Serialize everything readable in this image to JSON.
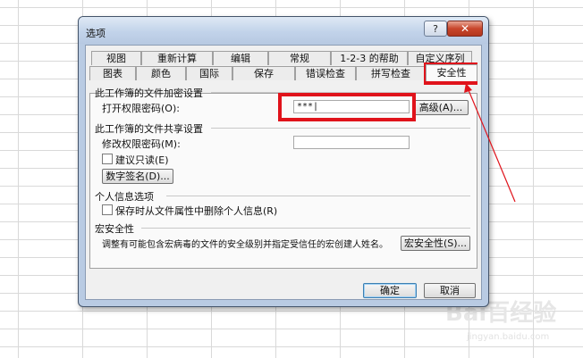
{
  "dialog": {
    "title": "选项",
    "help": "?",
    "close": "✕"
  },
  "tabs": {
    "row1": [
      "视图",
      "重新计算",
      "编辑",
      "常规",
      "1-2-3 的帮助",
      "自定义序列"
    ],
    "row2": [
      "图表",
      "颜色",
      "国际",
      "保存",
      "错误检查",
      "拼写检查",
      "安全性"
    ],
    "active": "安全性"
  },
  "encrypt": {
    "group": "此工作簿的文件加密设置",
    "open_label": "打开权限密码(O):",
    "open_value": "***|",
    "advanced_button": "高级(A)..."
  },
  "share": {
    "group": "此工作簿的文件共享设置",
    "modify_label": "修改权限密码(M):",
    "modify_value": "",
    "readonly_label": "建议只读(E)",
    "signature_button": "数字签名(D)..."
  },
  "privacy": {
    "group": "个人信息选项",
    "remove_label": "保存时从文件属性中删除个人信息(R)"
  },
  "macro": {
    "group": "宏安全性",
    "description": "调整有可能包含宏病毒的文件的安全级别并指定受信任的宏创建人姓名。",
    "button": "宏安全性(S)..."
  },
  "footer": {
    "ok": "确定",
    "cancel": "取消"
  },
  "watermark": {
    "text": "Bai百经验",
    "sub": "jingyan.baidu.com"
  },
  "colors": {
    "highlight": "#e0131b"
  }
}
